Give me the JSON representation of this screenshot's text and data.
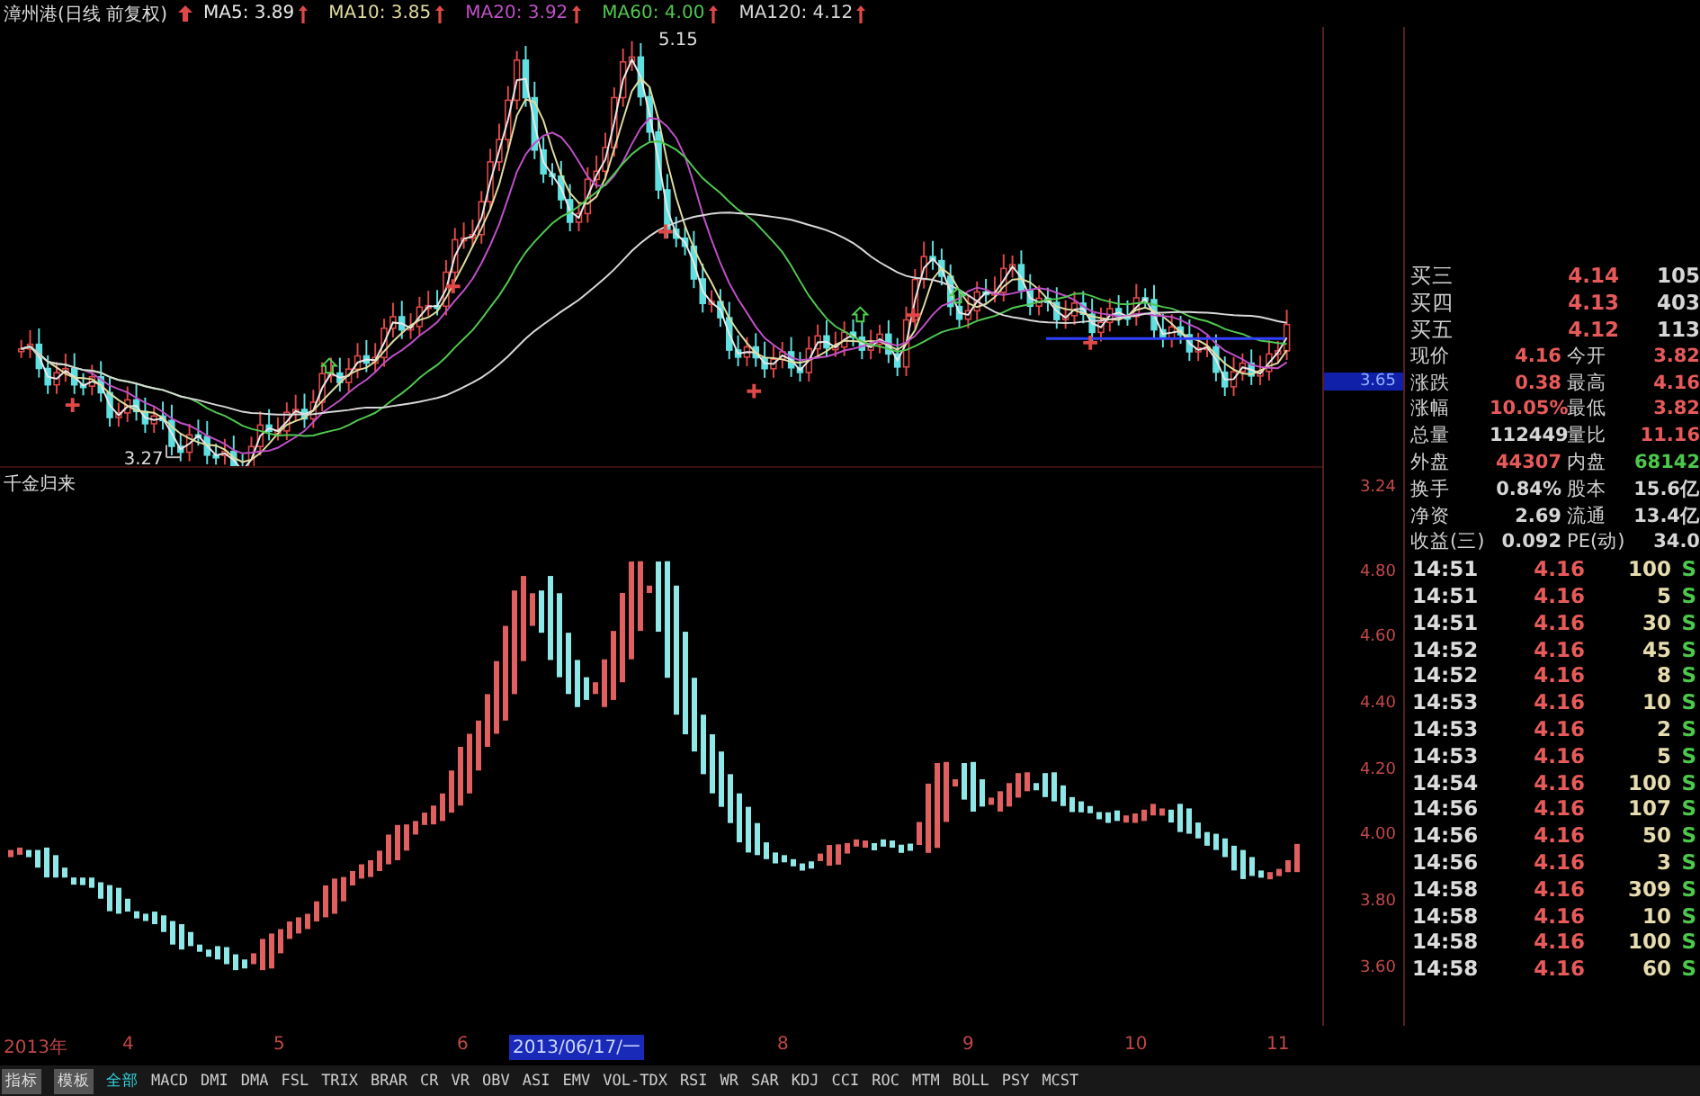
{
  "header": {
    "title": "漳州港(日线 前复权)",
    "indicators": [
      {
        "label": "MA5: 3.89",
        "color": "#e8e8e8"
      },
      {
        "label": "MA10: 3.85",
        "color": "#e0dca0"
      },
      {
        "label": "MA20: 3.92",
        "color": "#c050c8"
      },
      {
        "label": "MA60: 4.00",
        "color": "#50c850"
      },
      {
        "label": "MA120: 4.12",
        "color": "#d8d8d8"
      }
    ]
  },
  "main_chart": {
    "annotations": [
      "5.15",
      "3.27"
    ],
    "axis_labels": [
      {
        "text": "3.65",
        "highlighted": true
      },
      {
        "text": "3.24",
        "highlighted": false
      }
    ]
  },
  "indicator_chart": {
    "title": "千金归来",
    "axis_labels": [
      "4.80",
      "4.60",
      "4.40",
      "4.20",
      "4.00",
      "3.80",
      "3.60"
    ]
  },
  "order_book": [
    {
      "label": "买三",
      "price": "4.14",
      "volume": "105"
    },
    {
      "label": "买四",
      "price": "4.13",
      "volume": "403"
    },
    {
      "label": "买五",
      "price": "4.12",
      "volume": "113"
    }
  ],
  "quote_rows": [
    {
      "cells": [
        {
          "label": "现价",
          "value": "4.16",
          "color": "#e85a5a"
        },
        {
          "label": "今开",
          "value": "3.82",
          "color": "#e85a5a"
        }
      ]
    },
    {
      "cells": [
        {
          "label": "涨跌",
          "value": "0.38",
          "color": "#e85a5a"
        },
        {
          "label": "最高",
          "value": "4.16",
          "color": "#e85a5a"
        }
      ]
    },
    {
      "cells": [
        {
          "label": "涨幅",
          "value": "10.05%",
          "color": "#e85a5a"
        },
        {
          "label": "最低",
          "value": "3.82",
          "color": "#e85a5a"
        }
      ]
    },
    {
      "cells": [
        {
          "label": "总量",
          "value": "112449",
          "color": "#d6d6d6"
        },
        {
          "label": "量比",
          "value": "11.16",
          "color": "#e85a5a"
        }
      ]
    },
    {
      "cells": [
        {
          "label": "外盘",
          "value": "44307",
          "color": "#e85a5a"
        },
        {
          "label": "内盘",
          "value": "68142",
          "color": "#4cc84c"
        }
      ]
    },
    {
      "cells": [
        {
          "label": "换手",
          "value": "0.84%",
          "color": "#d6d6d6"
        },
        {
          "label": "股本",
          "value": "15.6亿",
          "color": "#d6d6d6"
        }
      ]
    },
    {
      "cells": [
        {
          "label": "净资",
          "value": "2.69",
          "color": "#d6d6d6"
        },
        {
          "label": "流通",
          "value": "13.4亿",
          "color": "#d6d6d6"
        }
      ]
    },
    {
      "cells": [
        {
          "label": "收益(三)",
          "value": "0.092",
          "color": "#d6d6d6"
        },
        {
          "label": "PE(动)",
          "value": "34.0",
          "color": "#d6d6d6"
        }
      ]
    }
  ],
  "ticks": [
    {
      "time": "14:51",
      "price": "4.16",
      "volume": "100",
      "side": "S"
    },
    {
      "time": "14:51",
      "price": "4.16",
      "volume": "5",
      "side": "S"
    },
    {
      "time": "14:51",
      "price": "4.16",
      "volume": "30",
      "side": "S"
    },
    {
      "time": "14:52",
      "price": "4.16",
      "volume": "45",
      "side": "S"
    },
    {
      "time": "14:52",
      "price": "4.16",
      "volume": "8",
      "side": "S"
    },
    {
      "time": "14:53",
      "price": "4.16",
      "volume": "10",
      "side": "S"
    },
    {
      "time": "14:53",
      "price": "4.16",
      "volume": "2",
      "side": "S"
    },
    {
      "time": "14:53",
      "price": "4.16",
      "volume": "5",
      "side": "S"
    },
    {
      "time": "14:54",
      "price": "4.16",
      "volume": "100",
      "side": "S"
    },
    {
      "time": "14:56",
      "price": "4.16",
      "volume": "107",
      "side": "S"
    },
    {
      "time": "14:56",
      "price": "4.16",
      "volume": "50",
      "side": "S"
    },
    {
      "time": "14:56",
      "price": "4.16",
      "volume": "3",
      "side": "S"
    },
    {
      "time": "14:58",
      "price": "4.16",
      "volume": "309",
      "side": "S"
    },
    {
      "time": "14:58",
      "price": "4.16",
      "volume": "10",
      "side": "S"
    },
    {
      "time": "14:58",
      "price": "4.16",
      "volume": "100",
      "side": "S"
    },
    {
      "time": "14:58",
      "price": "4.16",
      "volume": "60",
      "side": "S"
    }
  ],
  "x_axis": [
    {
      "text": "2013年",
      "highlighted": false
    },
    {
      "text": "4",
      "highlighted": false
    },
    {
      "text": "5",
      "highlighted": false
    },
    {
      "text": "6",
      "highlighted": false
    },
    {
      "text": "2013/06/17/一",
      "highlighted": true
    },
    {
      "text": "8",
      "highlighted": false
    },
    {
      "text": "9",
      "highlighted": false
    },
    {
      "text": "10",
      "highlighted": false
    },
    {
      "text": "11",
      "highlighted": false
    }
  ],
  "buttons": [
    "指标",
    "模板"
  ],
  "tabs": [
    {
      "label": "全部",
      "selected": true
    },
    {
      "label": "MACD",
      "selected": false
    },
    {
      "label": "DMI",
      "selected": false
    },
    {
      "label": "DMA",
      "selected": false
    },
    {
      "label": "FSL",
      "selected": false
    },
    {
      "label": "TRIX",
      "selected": false
    },
    {
      "label": "BRAR",
      "selected": false
    },
    {
      "label": "CR",
      "selected": false
    },
    {
      "label": "VR",
      "selected": false
    },
    {
      "label": "OBV",
      "selected": false
    },
    {
      "label": "ASI",
      "selected": false
    },
    {
      "label": "EMV",
      "selected": false
    },
    {
      "label": "VOL-TDX",
      "selected": false
    },
    {
      "label": "RSI",
      "selected": false
    },
    {
      "label": "WR",
      "selected": false
    },
    {
      "label": "SAR",
      "selected": false
    },
    {
      "label": "KDJ",
      "selected": false
    },
    {
      "label": "CCI",
      "selected": false
    },
    {
      "label": "ROC",
      "selected": false
    },
    {
      "label": "MTM",
      "selected": false
    },
    {
      "label": "BOLL",
      "selected": false
    },
    {
      "label": "PSY",
      "selected": false
    },
    {
      "label": "MCST",
      "selected": false
    }
  ]
}
